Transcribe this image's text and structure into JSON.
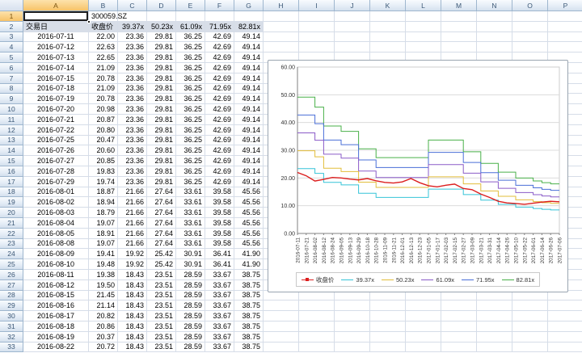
{
  "sheet": {
    "columns": [
      "A",
      "B",
      "C",
      "D",
      "E",
      "F",
      "G",
      "H",
      "I",
      "J",
      "K",
      "L",
      "M",
      "N",
      "O",
      "P"
    ],
    "row_count": 33,
    "selected_cell": "A1",
    "cells": {
      "B1": "300059.SZ"
    }
  },
  "table": {
    "headers": [
      "交易日",
      "收盘价",
      "39.37x",
      "50.23x",
      "61.09x",
      "71.95x",
      "82.81x"
    ],
    "rows": [
      [
        "2016-07-11",
        "22.00",
        "23.36",
        "29.81",
        "36.25",
        "42.69",
        "49.14"
      ],
      [
        "2016-07-12",
        "22.63",
        "23.36",
        "29.81",
        "36.25",
        "42.69",
        "49.14"
      ],
      [
        "2016-07-13",
        "22.65",
        "23.36",
        "29.81",
        "36.25",
        "42.69",
        "49.14"
      ],
      [
        "2016-07-14",
        "21.09",
        "23.36",
        "29.81",
        "36.25",
        "42.69",
        "49.14"
      ],
      [
        "2016-07-15",
        "20.78",
        "23.36",
        "29.81",
        "36.25",
        "42.69",
        "49.14"
      ],
      [
        "2016-07-18",
        "21.09",
        "23.36",
        "29.81",
        "36.25",
        "42.69",
        "49.14"
      ],
      [
        "2016-07-19",
        "20.78",
        "23.36",
        "29.81",
        "36.25",
        "42.69",
        "49.14"
      ],
      [
        "2016-07-20",
        "20.98",
        "23.36",
        "29.81",
        "36.25",
        "42.69",
        "49.14"
      ],
      [
        "2016-07-21",
        "20.87",
        "23.36",
        "29.81",
        "36.25",
        "42.69",
        "49.14"
      ],
      [
        "2016-07-22",
        "20.80",
        "23.36",
        "29.81",
        "36.25",
        "42.69",
        "49.14"
      ],
      [
        "2016-07-25",
        "20.47",
        "23.36",
        "29.81",
        "36.25",
        "42.69",
        "49.14"
      ],
      [
        "2016-07-26",
        "20.60",
        "23.36",
        "29.81",
        "36.25",
        "42.69",
        "49.14"
      ],
      [
        "2016-07-27",
        "20.85",
        "23.36",
        "29.81",
        "36.25",
        "42.69",
        "49.14"
      ],
      [
        "2016-07-28",
        "19.83",
        "23.36",
        "29.81",
        "36.25",
        "42.69",
        "49.14"
      ],
      [
        "2016-07-29",
        "19.74",
        "23.36",
        "29.81",
        "36.25",
        "42.69",
        "49.14"
      ],
      [
        "2016-08-01",
        "18.87",
        "21.66",
        "27.64",
        "33.61",
        "39.58",
        "45.56"
      ],
      [
        "2016-08-02",
        "18.94",
        "21.66",
        "27.64",
        "33.61",
        "39.58",
        "45.56"
      ],
      [
        "2016-08-03",
        "18.79",
        "21.66",
        "27.64",
        "33.61",
        "39.58",
        "45.56"
      ],
      [
        "2016-08-04",
        "19.07",
        "21.66",
        "27.64",
        "33.61",
        "39.58",
        "45.56"
      ],
      [
        "2016-08-05",
        "18.91",
        "21.66",
        "27.64",
        "33.61",
        "39.58",
        "45.56"
      ],
      [
        "2016-08-08",
        "19.07",
        "21.66",
        "27.64",
        "33.61",
        "39.58",
        "45.56"
      ],
      [
        "2016-08-09",
        "19.41",
        "19.92",
        "25.42",
        "30.91",
        "36.41",
        "41.90"
      ],
      [
        "2016-08-10",
        "19.48",
        "19.92",
        "25.42",
        "30.91",
        "36.41",
        "41.90"
      ],
      [
        "2016-08-11",
        "19.38",
        "18.43",
        "23.51",
        "28.59",
        "33.67",
        "38.75"
      ],
      [
        "2016-08-12",
        "19.50",
        "18.43",
        "23.51",
        "28.59",
        "33.67",
        "38.75"
      ],
      [
        "2016-08-15",
        "21.45",
        "18.43",
        "23.51",
        "28.59",
        "33.67",
        "38.75"
      ],
      [
        "2016-08-16",
        "21.14",
        "18.43",
        "23.51",
        "28.59",
        "33.67",
        "38.75"
      ],
      [
        "2016-08-17",
        "20.82",
        "18.43",
        "23.51",
        "28.59",
        "33.67",
        "38.75"
      ],
      [
        "2016-08-18",
        "20.86",
        "18.43",
        "23.51",
        "28.59",
        "33.67",
        "38.75"
      ],
      [
        "2016-08-19",
        "20.37",
        "18.43",
        "23.51",
        "28.59",
        "33.67",
        "38.75"
      ],
      [
        "2016-08-22",
        "20.72",
        "18.43",
        "23.51",
        "28.59",
        "33.67",
        "38.75"
      ]
    ]
  },
  "chart_data": {
    "type": "line",
    "title": "",
    "xlabel": "",
    "ylabel": "",
    "ylim": [
      0,
      60
    ],
    "y_ticks": [
      "60.00",
      "50.00",
      "40.00",
      "30.00",
      "20.00",
      "10.00",
      "0.00"
    ],
    "grid": true,
    "legend_position": "bottom",
    "x": [
      "2016-07-11",
      "2016-07-21",
      "2016-08-02",
      "2016-08-12",
      "2016-08-24",
      "2016-09-05",
      "2016-09-13",
      "2016-09-29",
      "2016-10-18",
      "2016-10-28",
      "2016-11-09",
      "2016-11-21",
      "2016-12-01",
      "2016-12-13",
      "2016-12-23",
      "2017-01-05",
      "2017-01-17",
      "2017-02-03",
      "2017-02-15",
      "2017-02-27",
      "2017-03-09",
      "2017-03-21",
      "2017-03-31",
      "2017-04-14",
      "2017-04-26",
      "2017-05-10",
      "2017-05-22",
      "2017-06-01",
      "2017-06-14",
      "2017-06-26",
      "2017-07-06"
    ],
    "series": [
      {
        "name": "收盘价",
        "color": "#dc1e1e",
        "marker": true,
        "step": false,
        "values": [
          22.0,
          20.8,
          18.9,
          19.5,
          20.2,
          20.0,
          19.6,
          19.3,
          19.8,
          19.0,
          18.4,
          18.2,
          18.6,
          19.8,
          18.3,
          17.2,
          16.8,
          17.4,
          17.8,
          16.2,
          15.8,
          14.2,
          13.0,
          11.6,
          11.0,
          10.8,
          10.5,
          10.9,
          11.3,
          11.6,
          11.4
        ]
      },
      {
        "name": "39.37x",
        "color": "#35c4d8",
        "marker": false,
        "step": true,
        "values": [
          23.36,
          23.36,
          21.66,
          18.43,
          18.43,
          17.5,
          17.5,
          14.5,
          14.5,
          13.0,
          13.0,
          13.0,
          13.0,
          13.0,
          13.0,
          16.0,
          16.0,
          16.0,
          16.0,
          14.0,
          14.0,
          12.0,
          12.0,
          10.5,
          10.5,
          9.5,
          9.5,
          9.0,
          8.7,
          8.5,
          8.5
        ]
      },
      {
        "name": "50.23x",
        "color": "#e2bd3a",
        "marker": false,
        "step": true,
        "values": [
          29.81,
          29.81,
          27.64,
          23.51,
          23.51,
          22.33,
          22.33,
          18.5,
          18.5,
          16.59,
          16.59,
          16.59,
          16.59,
          16.59,
          16.59,
          20.41,
          20.41,
          20.41,
          20.41,
          17.86,
          17.86,
          15.31,
          15.31,
          13.4,
          13.4,
          12.12,
          12.12,
          11.48,
          11.1,
          10.85,
          10.85
        ]
      },
      {
        "name": "61.09x",
        "color": "#8a5bc8",
        "marker": false,
        "step": true,
        "values": [
          36.25,
          36.25,
          33.61,
          28.59,
          28.59,
          27.16,
          27.16,
          22.5,
          22.5,
          20.17,
          20.17,
          20.17,
          20.17,
          20.17,
          20.17,
          24.83,
          24.83,
          24.83,
          24.83,
          21.72,
          21.72,
          18.62,
          18.62,
          16.29,
          16.29,
          14.74,
          14.74,
          13.97,
          13.5,
          13.19,
          13.19
        ]
      },
      {
        "name": "71.95x",
        "color": "#4a6fd8",
        "marker": false,
        "step": true,
        "values": [
          42.69,
          42.69,
          39.58,
          33.67,
          33.67,
          31.99,
          31.99,
          26.5,
          26.5,
          23.76,
          23.76,
          23.76,
          23.76,
          23.76,
          23.76,
          29.24,
          29.24,
          29.24,
          29.24,
          25.59,
          25.59,
          21.93,
          21.93,
          19.19,
          19.19,
          17.36,
          17.36,
          16.45,
          15.9,
          15.54,
          15.54
        ]
      },
      {
        "name": "82.81x",
        "color": "#49b049",
        "marker": false,
        "step": true,
        "values": [
          49.14,
          49.14,
          45.56,
          38.75,
          38.75,
          36.82,
          36.82,
          30.5,
          30.5,
          27.35,
          27.35,
          27.35,
          27.35,
          27.35,
          27.35,
          33.66,
          33.66,
          33.66,
          33.66,
          29.46,
          29.46,
          25.25,
          25.25,
          22.09,
          22.09,
          19.99,
          19.99,
          18.94,
          18.3,
          17.88,
          17.88
        ]
      }
    ]
  }
}
